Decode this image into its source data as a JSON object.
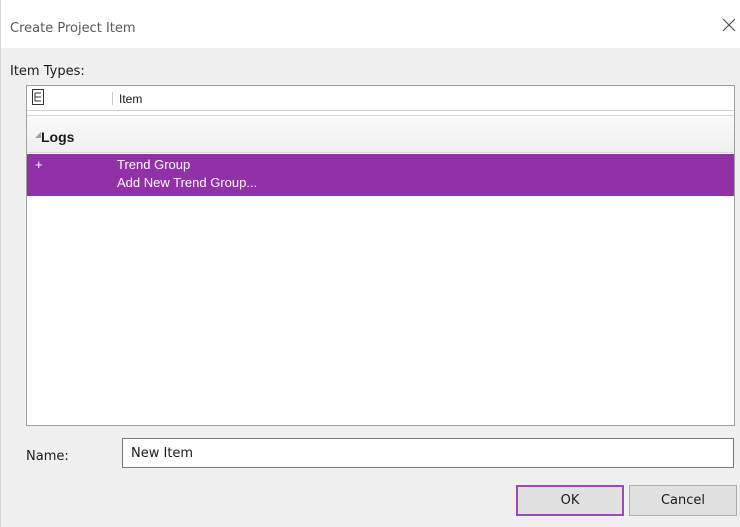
{
  "dialog": {
    "title": "Create Project Item",
    "close_icon": "close-icon"
  },
  "item_types": {
    "label": "Item  Types:",
    "column_header": "Item",
    "header_icon": "tree-view-icon",
    "group": {
      "label": "Logs",
      "expander_icon": "expand-triangle-icon"
    },
    "items": [
      {
        "icon": "+",
        "name": "Trend Group",
        "description": "Add New Trend Group..."
      }
    ],
    "selected_color": "#9130a7"
  },
  "name_field": {
    "label": "Name:",
    "value": "New Item"
  },
  "buttons": {
    "ok_label": "OK",
    "cancel_label": "Cancel"
  }
}
